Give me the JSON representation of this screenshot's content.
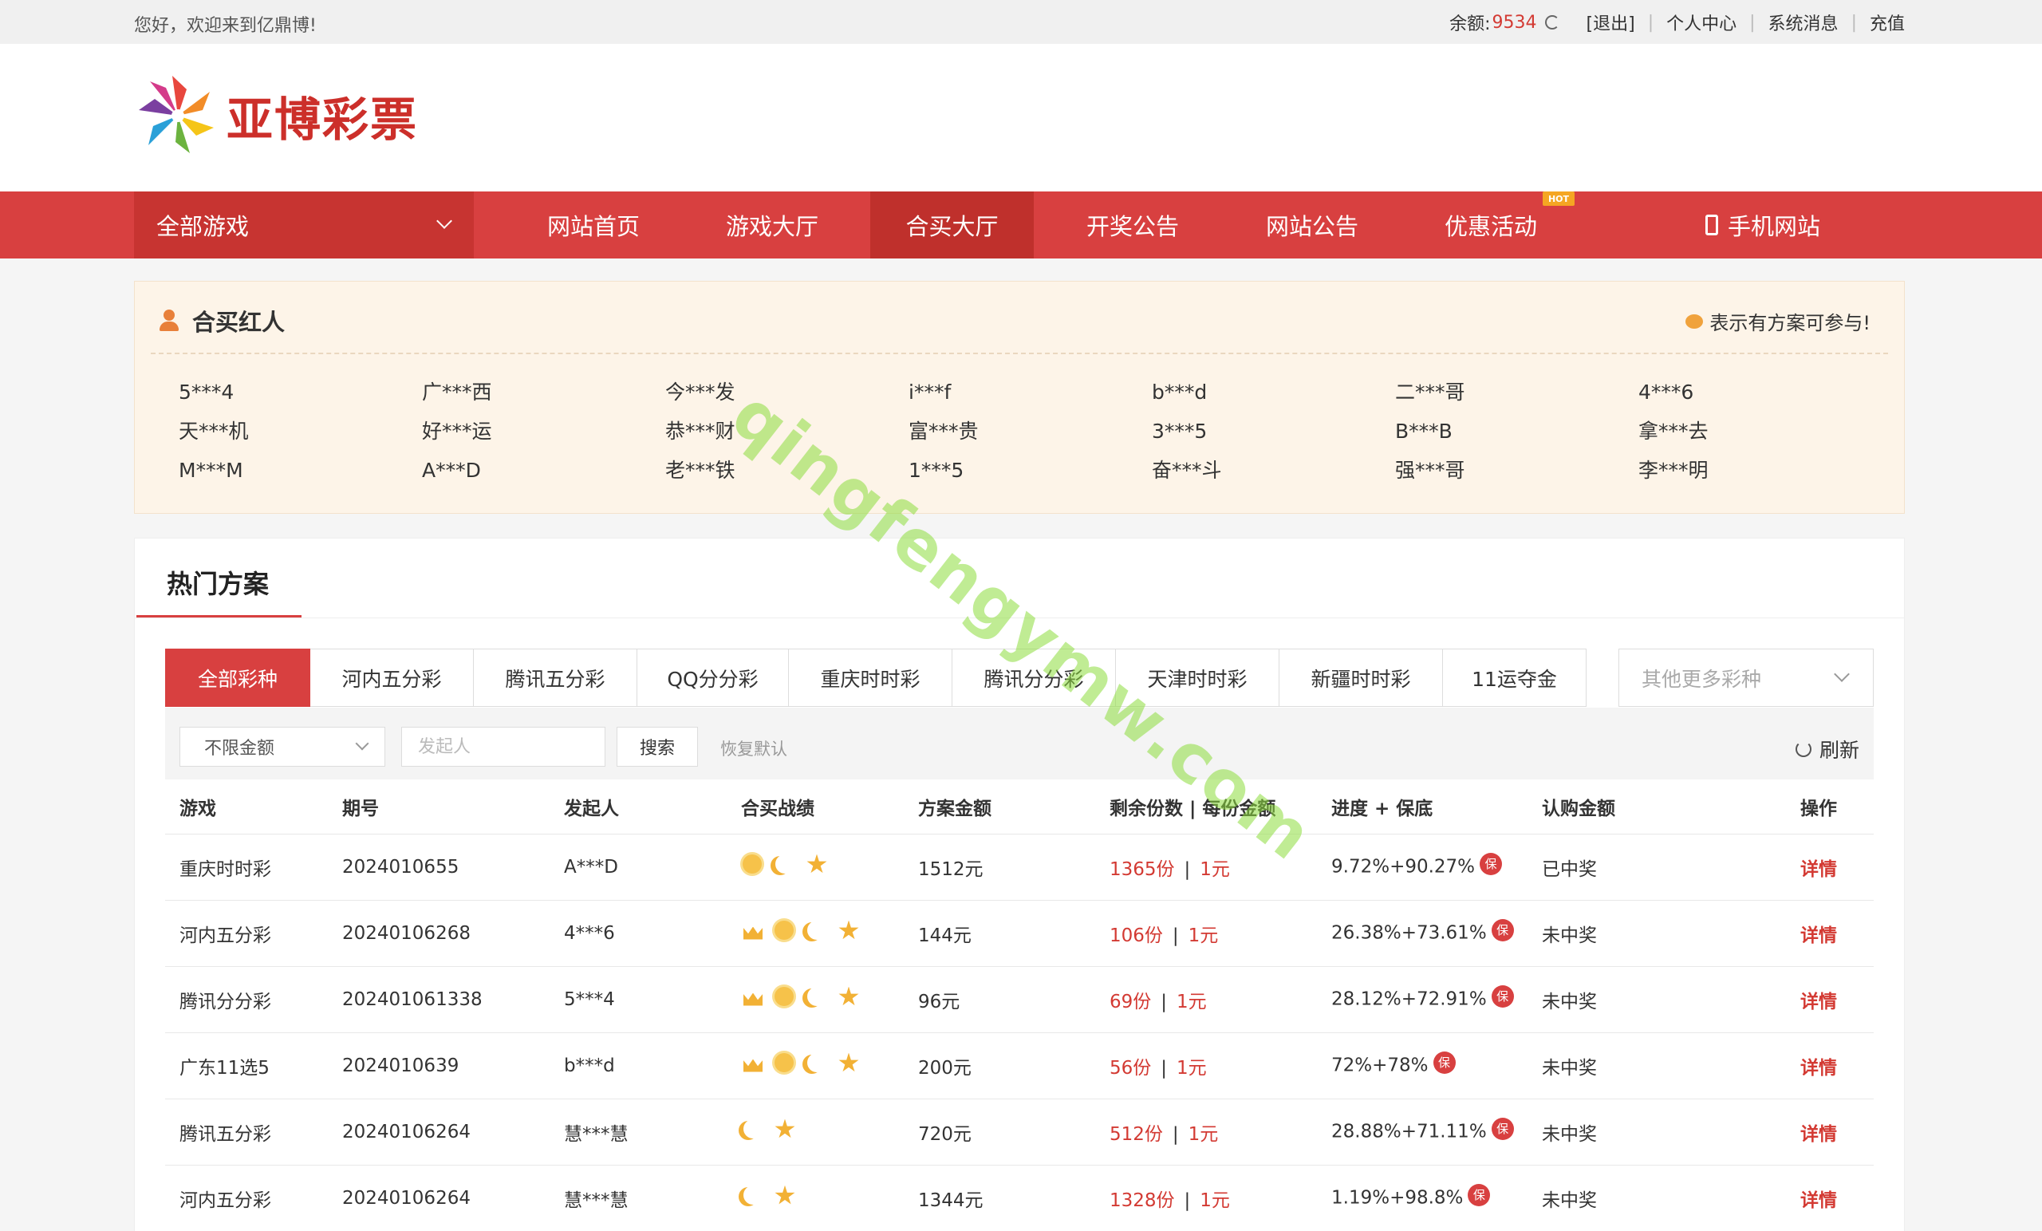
{
  "topbar": {
    "welcome": "您好，欢迎来到亿鼎博!",
    "balance_label": "余额:",
    "balance_value": "9534",
    "logout": "[退出]",
    "personal_center": "个人中心",
    "messages": "系统消息",
    "recharge": "充值"
  },
  "logo": {
    "text": "亚博彩票"
  },
  "nav": {
    "all_games": "全部游戏",
    "items": [
      "网站首页",
      "游戏大厅",
      "合买大厅",
      "开奖公告",
      "网站公告",
      "优惠活动",
      "手机网站"
    ],
    "active": "合买大厅",
    "hot_badge": "HOT"
  },
  "hongren": {
    "title": "合买红人",
    "hint": "表示有方案可参与!",
    "names": [
      "5***4",
      "广***西",
      "今***发",
      "i***f",
      "b***d",
      "二***哥",
      "4***6",
      "天***机",
      "好***运",
      "恭***财",
      "富***贵",
      "3***5",
      "B***B",
      "拿***去",
      "M***M",
      "A***D",
      "老***铁",
      "1***5",
      "奋***斗",
      "强***哥",
      "李***明"
    ]
  },
  "hot": {
    "title": "热门方案",
    "tabs": [
      "全部彩种",
      "河内五分彩",
      "腾讯五分彩",
      "QQ分分彩",
      "重庆时时彩",
      "腾讯分分彩",
      "天津时时彩",
      "新疆时时彩",
      "11运夺金"
    ],
    "more_placeholder": "其他更多彩种",
    "filter": {
      "amount_select": "不限金额",
      "faqi_placeholder": "发起人",
      "search": "搜索",
      "reset": "恢复默认",
      "refresh": "刷新"
    },
    "columns": [
      "游戏",
      "期号",
      "发起人",
      "合买战绩",
      "方案金额",
      "剩余份数 | 每份金额",
      "进度 + 保底",
      "认购金额",
      "操作"
    ],
    "bao_label": "保",
    "rows": [
      {
        "game": "重庆时时彩",
        "period": "2024010655",
        "initiator": "A***D",
        "record": [
          "sun",
          "moon",
          "star"
        ],
        "amount": "1512元",
        "remain": "1365份",
        "per": "1元",
        "progress": "9.72%+90.27%",
        "status": "已中奖",
        "won": true,
        "action": "详情"
      },
      {
        "game": "河内五分彩",
        "period": "20240106268",
        "initiator": "4***6",
        "record": [
          "crown",
          "sun",
          "moon",
          "star"
        ],
        "amount": "144元",
        "remain": "106份",
        "per": "1元",
        "progress": "26.38%+73.61%",
        "status": "未中奖",
        "won": false,
        "action": "详情"
      },
      {
        "game": "腾讯分分彩",
        "period": "202401061338",
        "initiator": "5***4",
        "record": [
          "crown",
          "sun",
          "moon",
          "star"
        ],
        "amount": "96元",
        "remain": "69份",
        "per": "1元",
        "progress": "28.12%+72.91%",
        "status": "未中奖",
        "won": false,
        "action": "详情"
      },
      {
        "game": "广东11选5",
        "period": "2024010639",
        "initiator": "b***d",
        "record": [
          "crown",
          "sun",
          "moon",
          "star"
        ],
        "amount": "200元",
        "remain": "56份",
        "per": "1元",
        "progress": "72%+78%",
        "status": "未中奖",
        "won": false,
        "action": "详情"
      },
      {
        "game": "腾讯五分彩",
        "period": "20240106264",
        "initiator": "慧***慧",
        "record": [
          "moon",
          "star"
        ],
        "amount": "720元",
        "remain": "512份",
        "per": "1元",
        "progress": "28.88%+71.11%",
        "status": "未中奖",
        "won": false,
        "action": "详情"
      },
      {
        "game": "河内五分彩",
        "period": "20240106264",
        "initiator": "慧***慧",
        "record": [
          "moon",
          "star"
        ],
        "amount": "1344元",
        "remain": "1328份",
        "per": "1元",
        "progress": "1.19%+98.8%",
        "status": "未中奖",
        "won": false,
        "action": "详情"
      }
    ]
  },
  "watermark": "qingfengymw.com"
}
